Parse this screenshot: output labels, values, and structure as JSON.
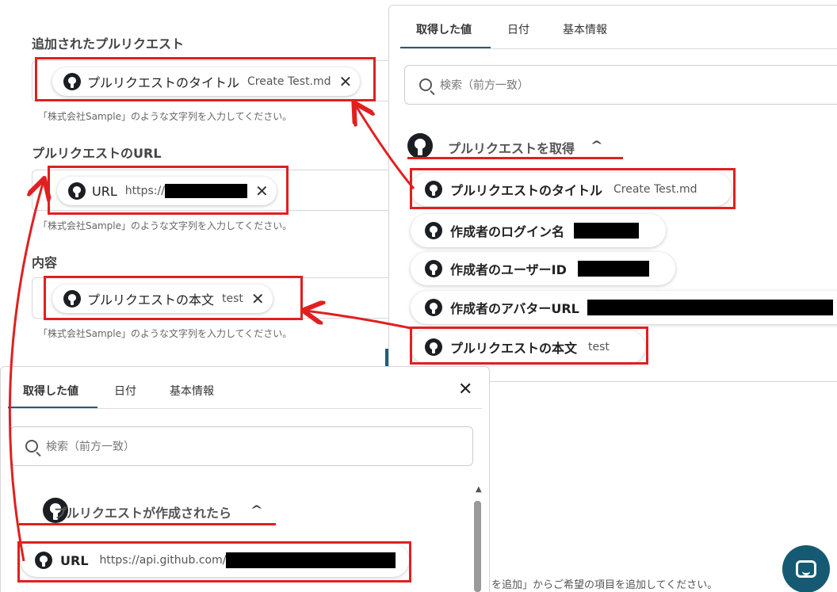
{
  "form": {
    "pr_label": "追加されたプルリクエスト",
    "pr_chip": {
      "name": "プルリクエストのタイトル",
      "value": "Create Test.md",
      "remove": "✕"
    },
    "help_text": "「株式会社Sample」のような文字列を入力してください。",
    "url_label": "プルリクエストのURL",
    "url_chip": {
      "name": "URL",
      "value": "https://",
      "remove": "✕"
    },
    "content_label": "内容",
    "body_chip": {
      "name": "プルリクエストの本文",
      "value": "test",
      "remove": "✕"
    }
  },
  "right_panel": {
    "tabs": [
      "取得した値",
      "日付",
      "基本情報"
    ],
    "search_placeholder": "検索（前方一致）",
    "group_title": "プルリクエストを取得",
    "chevron": "^",
    "items": [
      {
        "name": "プルリクエストのタイトル",
        "value": "Create Test.md"
      },
      {
        "name": "作成者のログイン名",
        "value": ""
      },
      {
        "name": "作成者のユーザーID",
        "value": ""
      },
      {
        "name": "作成者のアバターURL",
        "value": ""
      },
      {
        "name": "プルリクエストの本文",
        "value": "test"
      }
    ]
  },
  "bottom_panel": {
    "tabs": [
      "取得した値",
      "日付",
      "基本情報"
    ],
    "close": "✕",
    "search_placeholder": "検索（前方一致）",
    "group_title": "プルリクエストが作成されたら",
    "chevron": "^",
    "item": {
      "name": "URL",
      "value": "https://api.github.com/"
    }
  },
  "footer_text": "を追加」からご希望の項目を追加してください。",
  "colors": {
    "accent": "#1f5f74",
    "annotation": "#e02020",
    "help_button": "#155a72"
  }
}
